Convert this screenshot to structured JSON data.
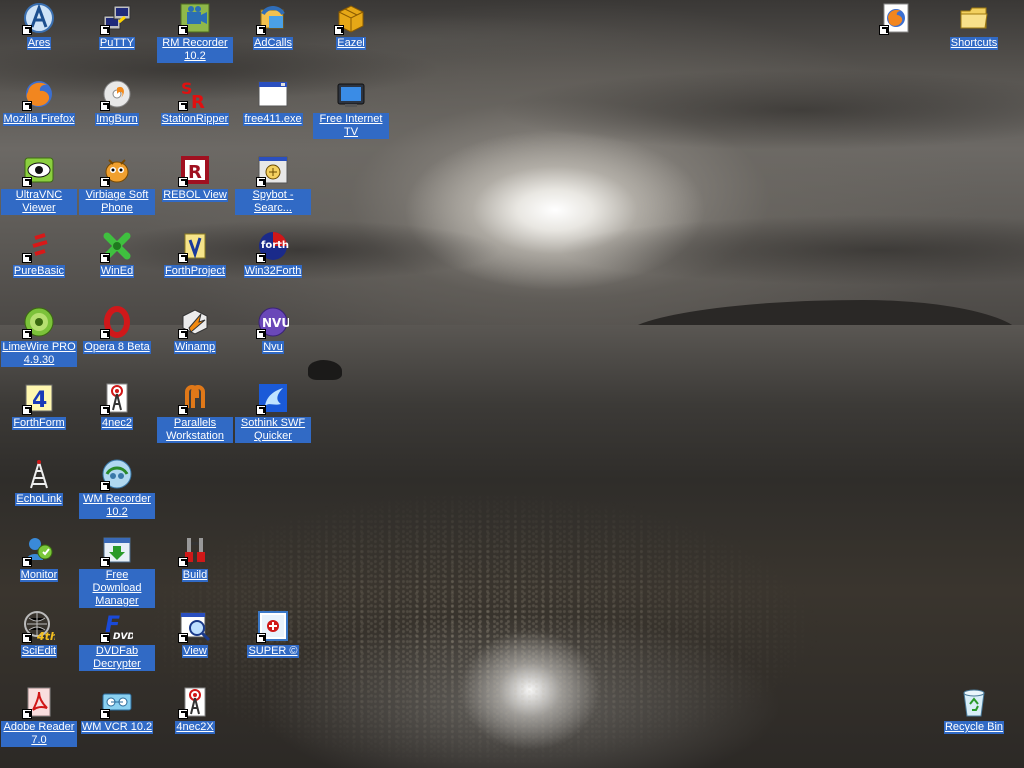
{
  "desktop": {
    "icons": [
      {
        "label": "Ares",
        "icon": "ares-icon"
      },
      {
        "label": "PuTTY",
        "icon": "putty-icon"
      },
      {
        "label": "RM Recorder 10.2",
        "icon": "rm-recorder-icon"
      },
      {
        "label": "AdCalls",
        "icon": "adcalls-icon"
      },
      {
        "label": "Eazel",
        "icon": "eazel-icon"
      },
      {
        "label": "Mozilla Firefox",
        "icon": "firefox-icon"
      },
      {
        "label": "ImgBurn",
        "icon": "imgburn-icon"
      },
      {
        "label": "StationRipper",
        "icon": "stationripper-icon"
      },
      {
        "label": "free411.exe",
        "icon": "exe-window-icon"
      },
      {
        "label": "Free Internet TV",
        "icon": "tv-icon"
      },
      {
        "label": "UltraVNC Viewer",
        "icon": "ultravnc-icon"
      },
      {
        "label": "Virbiage Soft Phone",
        "icon": "softphone-icon"
      },
      {
        "label": "REBOL View",
        "icon": "rebol-icon"
      },
      {
        "label": "Spybot - Searc...",
        "icon": "spybot-icon"
      },
      {
        "label": "PureBasic",
        "icon": "purebasic-icon"
      },
      {
        "label": "WinEd",
        "icon": "wined-icon"
      },
      {
        "label": "ForthProject",
        "icon": "forthproject-icon"
      },
      {
        "label": "Win32Forth",
        "icon": "win32forth-icon"
      },
      {
        "label": "LimeWire PRO 4.9.30",
        "icon": "limewire-icon"
      },
      {
        "label": "Opera 8 Beta",
        "icon": "opera-icon"
      },
      {
        "label": "Winamp",
        "icon": "winamp-icon"
      },
      {
        "label": "Nvu",
        "icon": "nvu-icon"
      },
      {
        "label": "ForthForm",
        "icon": "forthform-icon"
      },
      {
        "label": "4nec2",
        "icon": "antenna-icon"
      },
      {
        "label": "Parallels Workstation",
        "icon": "parallels-icon"
      },
      {
        "label": "Sothink SWF Quicker",
        "icon": "sothink-icon"
      },
      {
        "label": "EchoLink",
        "icon": "echolink-icon"
      },
      {
        "label": "WM Recorder 10.2",
        "icon": "wm-recorder-icon"
      },
      {
        "label": "Monitor",
        "icon": "monitor-icon"
      },
      {
        "label": "Free Download Manager",
        "icon": "download-manager-icon"
      },
      {
        "label": "Build",
        "icon": "build-icon"
      },
      {
        "label": "SciEdit",
        "icon": "sciedit-icon"
      },
      {
        "label": "DVDFab Decrypter",
        "icon": "dvdfab-icon"
      },
      {
        "label": "View",
        "icon": "view-icon"
      },
      {
        "label": "SUPER ©",
        "icon": "super-icon"
      },
      {
        "label": "Adobe Reader 7.0",
        "icon": "adobe-reader-icon"
      },
      {
        "label": "WM VCR 10.2",
        "icon": "wm-vcr-icon"
      },
      {
        "label": "4nec2X",
        "icon": "antenna-icon"
      },
      {
        "label": "",
        "icon": "firefox-icon"
      },
      {
        "label": "Shortcuts",
        "icon": "folder-icon"
      },
      {
        "label": "Recycle Bin",
        "icon": "recycle-bin-icon"
      }
    ]
  },
  "colors": {
    "selection": "#316ac5",
    "label_text": "#ffffff"
  }
}
